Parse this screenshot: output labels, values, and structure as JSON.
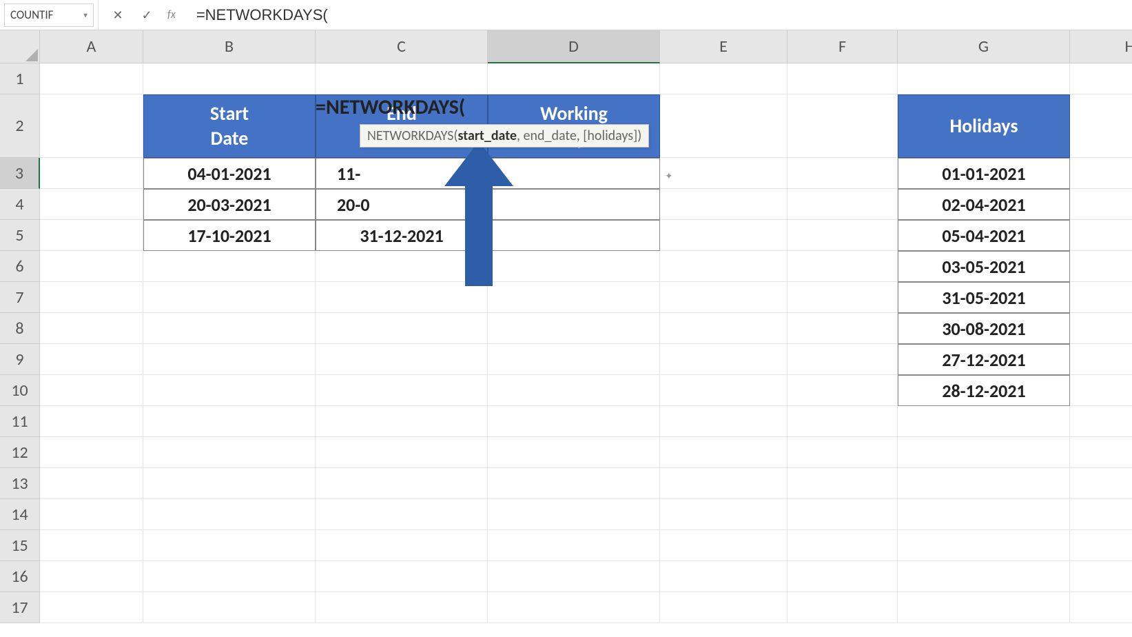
{
  "formula_bar": {
    "name_box": "COUNTIF",
    "cancel_icon": "✕",
    "confirm_icon": "✓",
    "fx_label": "fx",
    "formula": "=NETWORKDAYS("
  },
  "columns": [
    "A",
    "B",
    "C",
    "D",
    "E",
    "F",
    "G",
    "H"
  ],
  "rows": [
    "1",
    "2",
    "3",
    "4",
    "5",
    "6",
    "7",
    "8",
    "9",
    "10",
    "11",
    "12",
    "13",
    "14",
    "15",
    "16",
    "17"
  ],
  "active_column": "D",
  "active_row": "3",
  "headers": {
    "start_date": "Start\nDate",
    "end_date": "End\nDate",
    "working_days": "Working\nDays",
    "holidays": "Holidays"
  },
  "table_main": [
    {
      "start": "04-01-2021",
      "end_partial": "11-",
      "end_full": "=NETWORKDAYS(",
      "working": ""
    },
    {
      "start": "20-03-2021",
      "end": "20-0",
      "working": ""
    },
    {
      "start": "17-10-2021",
      "end": "31-12-2021",
      "working": ""
    }
  ],
  "holidays_list": [
    "01-01-2021",
    "02-04-2021",
    "05-04-2021",
    "03-05-2021",
    "31-05-2021",
    "30-08-2021",
    "27-12-2021",
    "28-12-2021"
  ],
  "editing_text": "=NETWORKDAYS(",
  "tooltip": {
    "fn_name": "NETWORKDAYS(",
    "arg1": "start_date",
    "args_rest": ", end_date, [holidays])"
  },
  "c4_partial": "20-0"
}
